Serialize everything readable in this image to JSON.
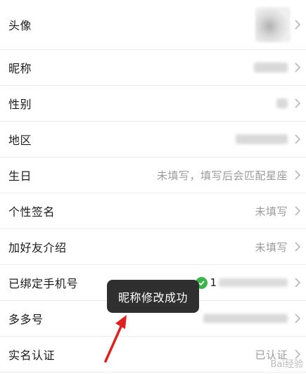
{
  "rows": [
    {
      "label": "头像"
    },
    {
      "label": "昵称"
    },
    {
      "label": "性别"
    },
    {
      "label": "地区"
    },
    {
      "label": "生日",
      "value": "未填写，填写后会匹配星座"
    },
    {
      "label": "个性签名",
      "value": "未填写"
    },
    {
      "label": "加好友介绍",
      "value": "未填写"
    },
    {
      "label": "已绑定手机号",
      "phone_prefix": "1"
    },
    {
      "label": "多多号"
    },
    {
      "label": "实名认证",
      "value": "已认证"
    }
  ],
  "toast": {
    "text": "昵称修改成功"
  },
  "watermark": {
    "text": "Bai经验"
  },
  "colors": {
    "toast_bg": "#2f2f2f",
    "arrow": "#e02020",
    "verified": "#3bb54a"
  }
}
